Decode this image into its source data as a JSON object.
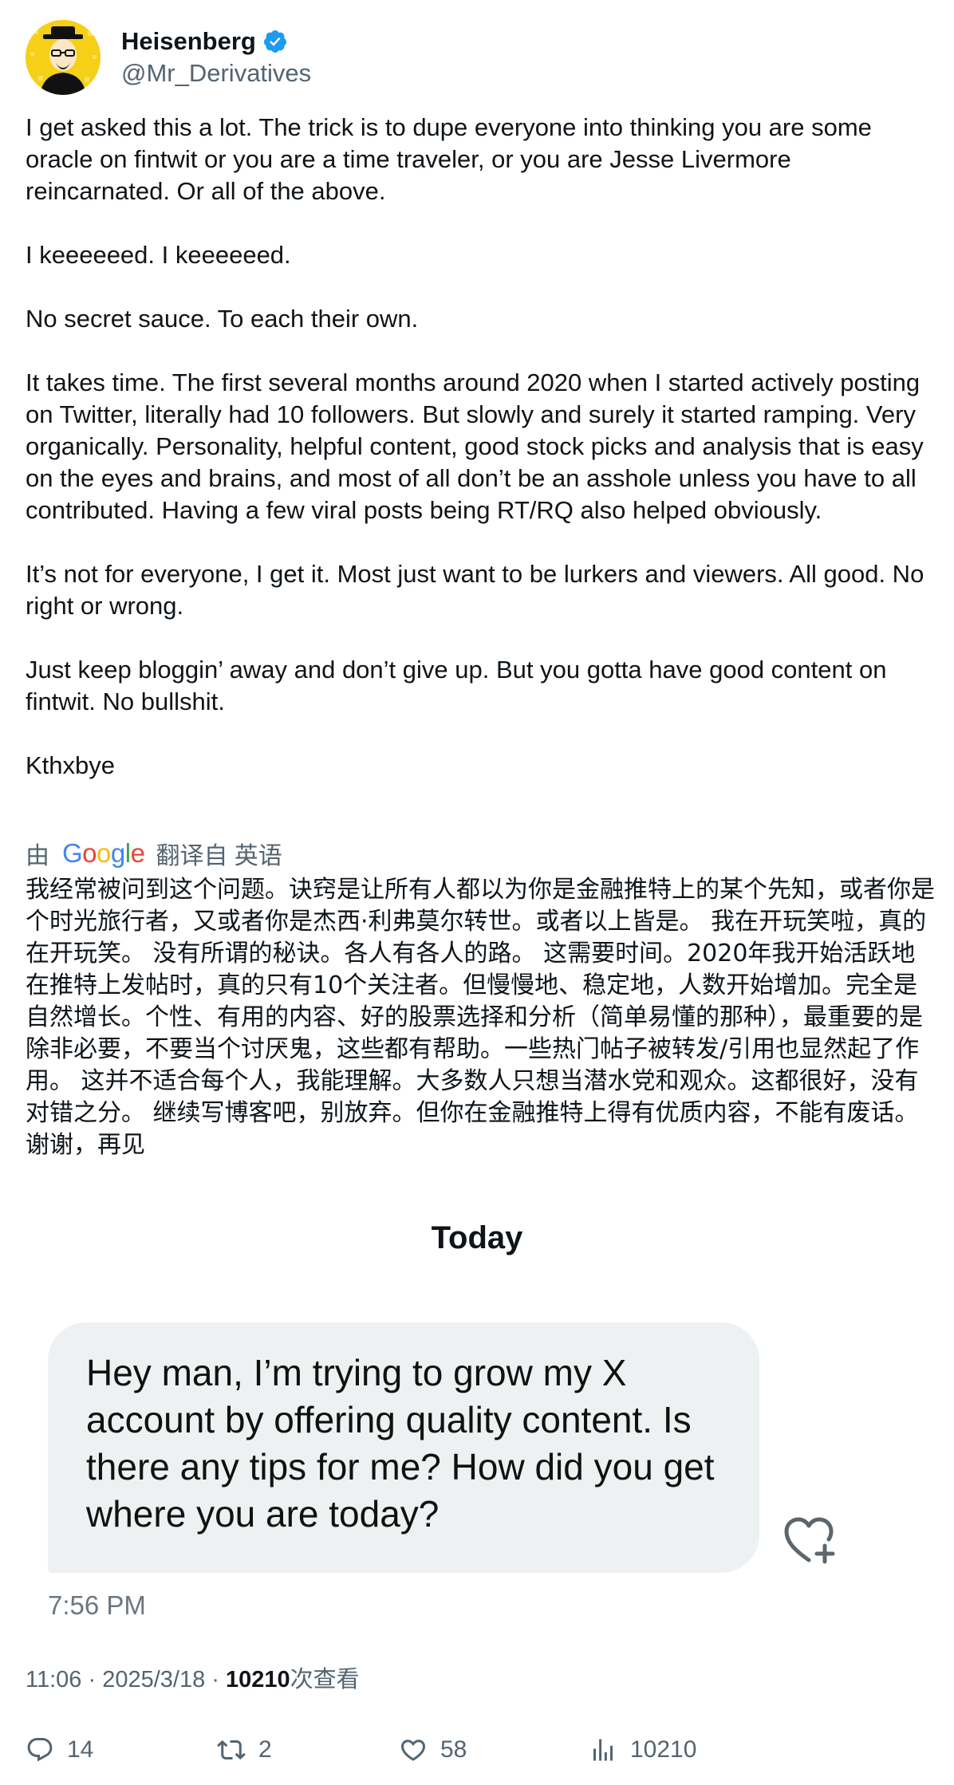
{
  "author": {
    "name": "Heisenberg",
    "handle": "@Mr_Derivatives",
    "verified": true
  },
  "tweet": {
    "paragraphs": [
      "I get asked this a lot. The trick is to dupe everyone into thinking you are some oracle on fintwit or you are a time traveler, or you are Jesse Livermore reincarnated. Or all of the above.",
      "I keeeeeed. I keeeeeed.",
      "No secret sauce. To each their own.",
      "It takes time. The first several months around 2020 when I started actively posting on Twitter, literally had 10 followers. But slowly and surely it started ramping. Very organically. Personality, helpful content, good stock picks and analysis that is easy on the eyes and brains, and most of all don’t be an asshole unless you have to all contributed. Having a few viral posts being RT/RQ also helped obviously.",
      "It’s not for everyone, I get it. Most just want to be lurkers and viewers. All good. No right or wrong.",
      "Just keep bloggin’ away and don’t give up. But you gotta have good content on fintwit. No bullshit.",
      "Kthxbye"
    ]
  },
  "translation": {
    "prefix": "由",
    "provider": "Google",
    "suffix": "翻译自 英语",
    "text": "我经常被问到这个问题。诀窍是让所有人都以为你是金融推特上的某个先知，或者你是个时光旅行者，又或者你是杰西·利弗莫尔转世。或者以上皆是。 我在开玩笑啦，真的在开玩笑。 没有所谓的秘诀。各人有各人的路。 这需要时间。2020年我开始活跃地在推特上发帖时，真的只有10个关注者。但慢慢地、稳定地，人数开始增加。完全是自然增长。个性、有用的内容、好的股票选择和分析（简单易懂的那种），最重要的是除非必要，不要当个讨厌鬼，这些都有帮助。一些热门帖子被转发/引用也显然起了作用。 这并不适合每个人，我能理解。大多数人只想当潜水党和观众。这都很好，没有对错之分。 继续写博客吧，别放弃。但你在金融推特上得有优质内容，不能有废话。 谢谢，再见"
  },
  "embedded_message": {
    "day_label": "Today",
    "message": "Hey man, I’m trying to grow my  X account by offering quality content. Is there any tips for me? How did you get where you are today?",
    "time": "7:56 PM"
  },
  "meta": {
    "time": "11:06",
    "date": "2025/3/18",
    "views_count": "10210",
    "views_label": "次查看"
  },
  "actions": {
    "replies": "14",
    "reposts": "2",
    "likes": "58",
    "views": "10210"
  },
  "colors": {
    "text": "#0f1419",
    "secondary": "#536471",
    "verified": "#1d9bf0",
    "bubble": "#eef1f2",
    "avatar": "#f6cf17"
  },
  "icons": [
    "avatar-heisenberg",
    "verified-badge-icon",
    "heart-plus-icon",
    "reply-icon",
    "repost-icon",
    "like-icon",
    "views-icon"
  ]
}
